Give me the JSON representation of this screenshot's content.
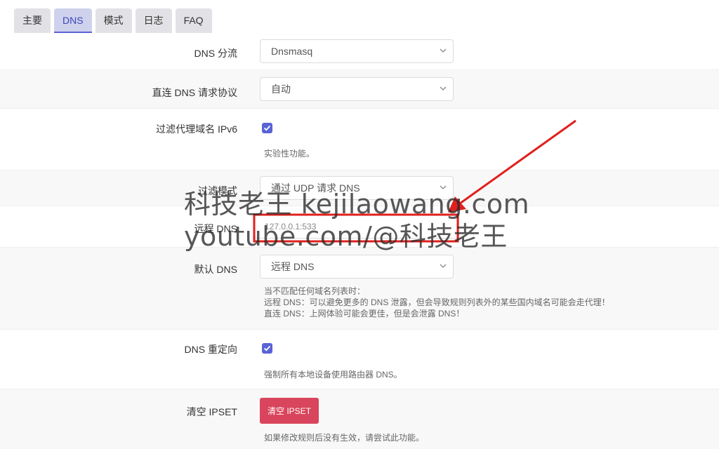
{
  "tabs": [
    {
      "label": "主要",
      "active": false
    },
    {
      "label": "DNS",
      "active": true
    },
    {
      "label": "模式",
      "active": false
    },
    {
      "label": "日志",
      "active": false
    },
    {
      "label": "FAQ",
      "active": false
    }
  ],
  "fields": {
    "dns_split": {
      "label": "DNS 分流",
      "value": "Dnsmasq"
    },
    "direct_dns_protocol": {
      "label": "直连 DNS 请求协议",
      "value": "自动"
    },
    "filter_ipv6": {
      "label": "过滤代理域名 IPv6",
      "checked": true,
      "desc": "实验性功能。"
    },
    "filter_mode": {
      "label": "过滤模式",
      "value": "通过 UDP 请求 DNS"
    },
    "remote_dns": {
      "label": "远程 DNS",
      "value": "127.0.0.1:533"
    },
    "default_dns": {
      "label": "默认 DNS",
      "value": "远程 DNS",
      "desc": [
        "当不匹配任何域名列表时：",
        "远程 DNS：可以避免更多的 DNS 泄露，但会导致规则列表外的某些国内域名可能会走代理！",
        "直连 DNS：上网体验可能会更佳，但是会泄露 DNS！"
      ]
    },
    "dns_redirect": {
      "label": "DNS 重定向",
      "checked": true,
      "desc": "强制所有本地设备使用路由器 DNS。"
    },
    "clear_ipset": {
      "label": "清空 IPSET",
      "button": "清空 IPSET",
      "desc": "如果修改规则后没有生效，请尝试此功能。"
    }
  },
  "watermark": {
    "line1": "科技老王 kejilaowang.com",
    "line2": "youtube.com/@科技老王"
  },
  "colors": {
    "accent": "#5a63d6",
    "danger": "#d9455c",
    "annotation": "#e0201c"
  }
}
